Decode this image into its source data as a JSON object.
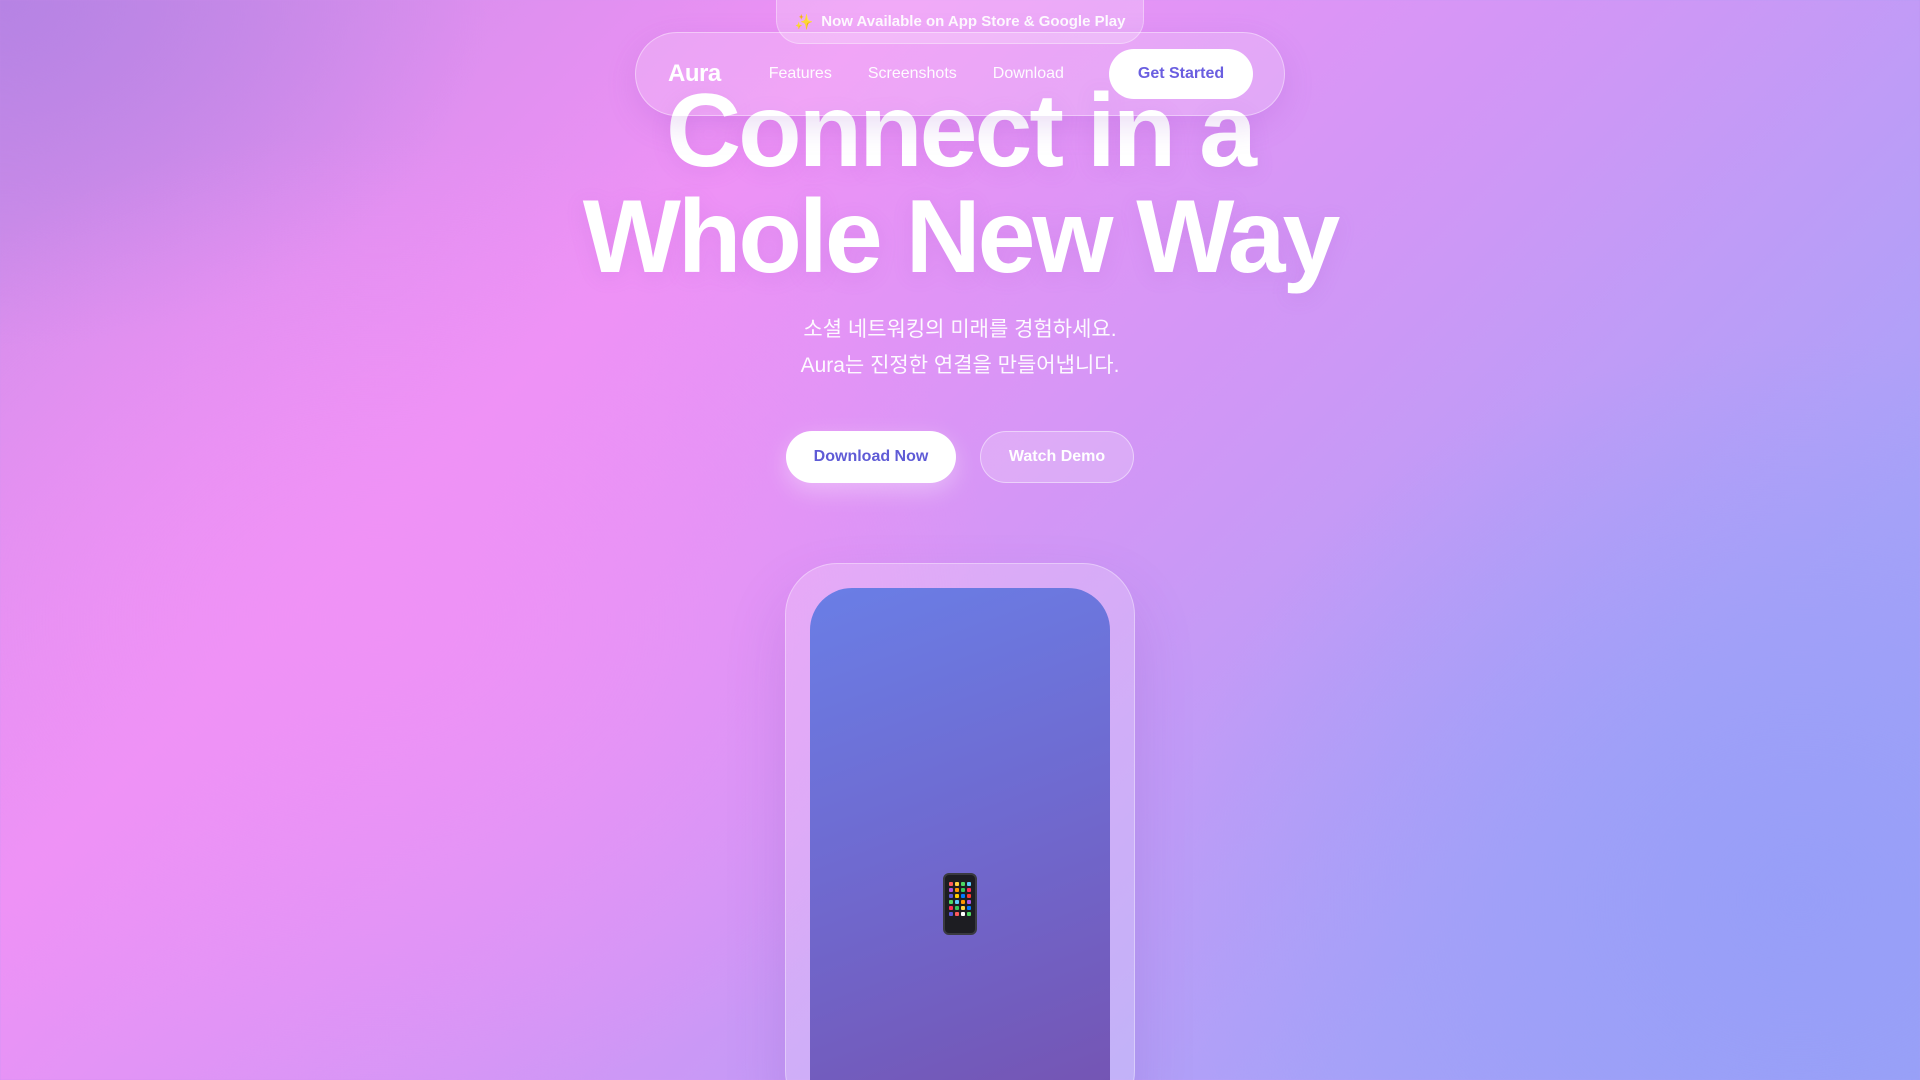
{
  "announcement": {
    "icon": "sparkles-icon",
    "text": "Now Available on App Store & Google Play"
  },
  "nav": {
    "logo": "Aura",
    "links": [
      "Features",
      "Screenshots",
      "Download"
    ],
    "cta": "Get Started"
  },
  "hero": {
    "title_line1": "Connect in a",
    "title_line2": "Whole New Way",
    "subtitle_line1": "소셜 네트워킹의 미래를 경험하세요.",
    "subtitle_line2": "Aura는 진정한 연결을 만들어냅니다.",
    "primary_button": "Download Now",
    "secondary_button": "Watch Demo"
  },
  "mockup": {
    "icon": "mobile-phone-icon"
  },
  "colors": {
    "accent_text": "#5f5bd6",
    "phone_gradient_start": "#6a7ee6",
    "phone_gradient_end": "#7552b0"
  }
}
